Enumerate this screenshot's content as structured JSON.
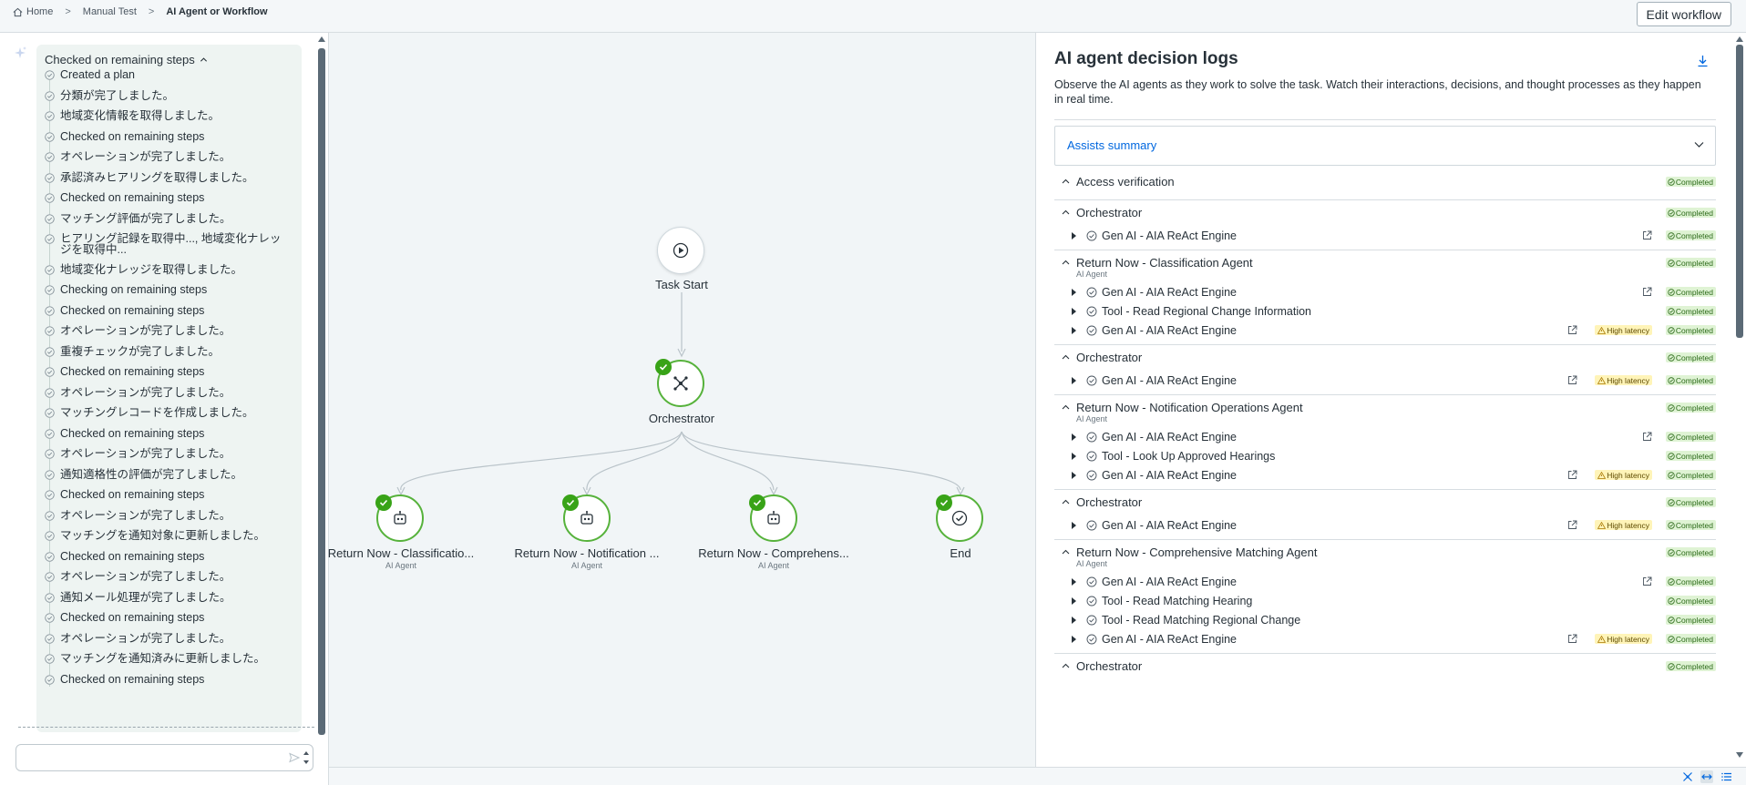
{
  "breadcrumb": {
    "items": [
      "Home",
      "Manual Test",
      "AI Agent or Workflow"
    ]
  },
  "header": {
    "edit_label": "Edit workflow"
  },
  "chat": {
    "header": "Checked on remaining steps",
    "steps": [
      "Created a plan",
      "分類が完了しました。",
      "地域変化情報を取得しました。",
      "Checked on remaining steps",
      "オペレーションが完了しました。",
      "承認済みヒアリングを取得しました。",
      "Checked on remaining steps",
      "マッチング評価が完了しました。",
      "ヒアリング記録を取得中..., 地域変化ナレッジを取得中...",
      "地域変化ナレッジを取得しました。",
      "Checking on remaining steps",
      "Checked on remaining steps",
      "オペレーションが完了しました。",
      "重複チェックが完了しました。",
      "Checked on remaining steps",
      "オペレーションが完了しました。",
      "マッチングレコードを作成しました。",
      "Checked on remaining steps",
      "オペレーションが完了しました。",
      "通知適格性の評価が完了しました。",
      "Checked on remaining steps",
      "オペレーションが完了しました。",
      "マッチングを通知対象に更新しました。",
      "Checked on remaining steps",
      "オペレーションが完了しました。",
      "通知メール処理が完了しました。",
      "Checked on remaining steps",
      "オペレーションが完了しました。",
      "マッチングを通知済みに更新しました。",
      "Checked on remaining steps"
    ],
    "input_value": ""
  },
  "workflow": {
    "start": {
      "label": "Task Start"
    },
    "orchestrator": {
      "label": "Orchestrator"
    },
    "children": [
      {
        "label": "Return Now - Classificatio...",
        "sub": "AI Agent"
      },
      {
        "label": "Return Now - Notification ...",
        "sub": "AI Agent"
      },
      {
        "label": "Return Now - Comprehens...",
        "sub": "AI Agent"
      },
      {
        "label": "End",
        "sub": ""
      }
    ]
  },
  "logs": {
    "title": "AI agent decision logs",
    "description": "Observe the AI agents as they work to solve the task. Watch their interactions, decisions, and thought processes as they happen in real time.",
    "assists_label": "Assists summary",
    "status_completed": "Completed",
    "high_latency": "High latency",
    "groups": [
      {
        "title": "Access verification",
        "sub": "",
        "items": []
      },
      {
        "title": "Orchestrator",
        "sub": "",
        "items": [
          {
            "title": "Gen AI - AIA ReAct Engine",
            "ext": true,
            "latency": false
          }
        ]
      },
      {
        "title": "Return Now - Classification Agent",
        "sub": "AI Agent",
        "items": [
          {
            "title": "Gen AI - AIA ReAct Engine",
            "ext": true,
            "latency": false
          },
          {
            "title": "Tool - Read Regional Change Information",
            "ext": false,
            "latency": false
          },
          {
            "title": "Gen AI - AIA ReAct Engine",
            "ext": true,
            "latency": true
          }
        ]
      },
      {
        "title": "Orchestrator",
        "sub": "",
        "items": [
          {
            "title": "Gen AI - AIA ReAct Engine",
            "ext": true,
            "latency": true
          }
        ]
      },
      {
        "title": "Return Now - Notification Operations Agent",
        "sub": "AI Agent",
        "items": [
          {
            "title": "Gen AI - AIA ReAct Engine",
            "ext": true,
            "latency": false
          },
          {
            "title": "Tool - Look Up Approved Hearings",
            "ext": false,
            "latency": false
          },
          {
            "title": "Gen AI - AIA ReAct Engine",
            "ext": true,
            "latency": true
          }
        ]
      },
      {
        "title": "Orchestrator",
        "sub": "",
        "items": [
          {
            "title": "Gen AI - AIA ReAct Engine",
            "ext": true,
            "latency": true
          }
        ]
      },
      {
        "title": "Return Now - Comprehensive Matching Agent",
        "sub": "AI Agent",
        "items": [
          {
            "title": "Gen AI - AIA ReAct Engine",
            "ext": true,
            "latency": false
          },
          {
            "title": "Tool - Read Matching Hearing",
            "ext": false,
            "latency": false
          },
          {
            "title": "Tool - Read Matching Regional Change",
            "ext": false,
            "latency": false
          },
          {
            "title": "Gen AI - AIA ReAct Engine",
            "ext": true,
            "latency": true
          }
        ]
      },
      {
        "title": "Orchestrator",
        "sub": "",
        "items": []
      }
    ]
  },
  "colors": {
    "accent_blue": "#0067df",
    "success_green": "#38a317",
    "completed_bg": "#dff3d4",
    "latency_bg": "#fff4b8"
  },
  "icons": {
    "home": "home-icon",
    "sparkle": "sparkle-icon",
    "download": "download-icon",
    "play": "play-icon",
    "orchestrator": "network-icon",
    "agent": "robot-icon",
    "end": "check-circle-icon",
    "external": "external-link-icon"
  }
}
